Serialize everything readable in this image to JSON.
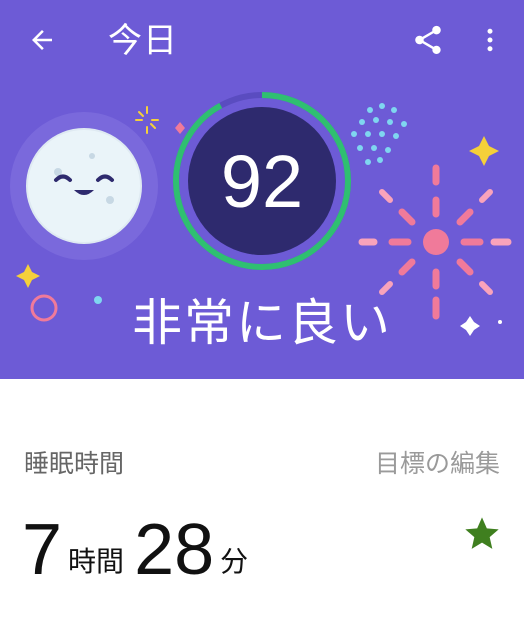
{
  "header": {
    "title": "今日",
    "back_icon": "arrow-left-icon",
    "share_icon": "share-icon",
    "more_icon": "more-vert-icon"
  },
  "score": {
    "value": "92",
    "progress": 0.92,
    "quality_label": "非常に良い"
  },
  "sleep_duration": {
    "section_label": "睡眠時間",
    "edit_goal_label": "目標の編集",
    "hours": "7",
    "hours_unit": "時間",
    "minutes": "28",
    "minutes_unit": "分",
    "goal_icon": "star-icon"
  },
  "colors": {
    "hero_background": "#6d5bd6",
    "ring_progress": "#2fbf71",
    "ring_track": "#5a4cc0",
    "score_circle": "#2e2a6e",
    "goal_star": "#3f7f1f",
    "firework_pink": "#f07a9a",
    "firework_cyan": "#7fd6f0",
    "sparkle_yellow": "#f5d03a"
  }
}
